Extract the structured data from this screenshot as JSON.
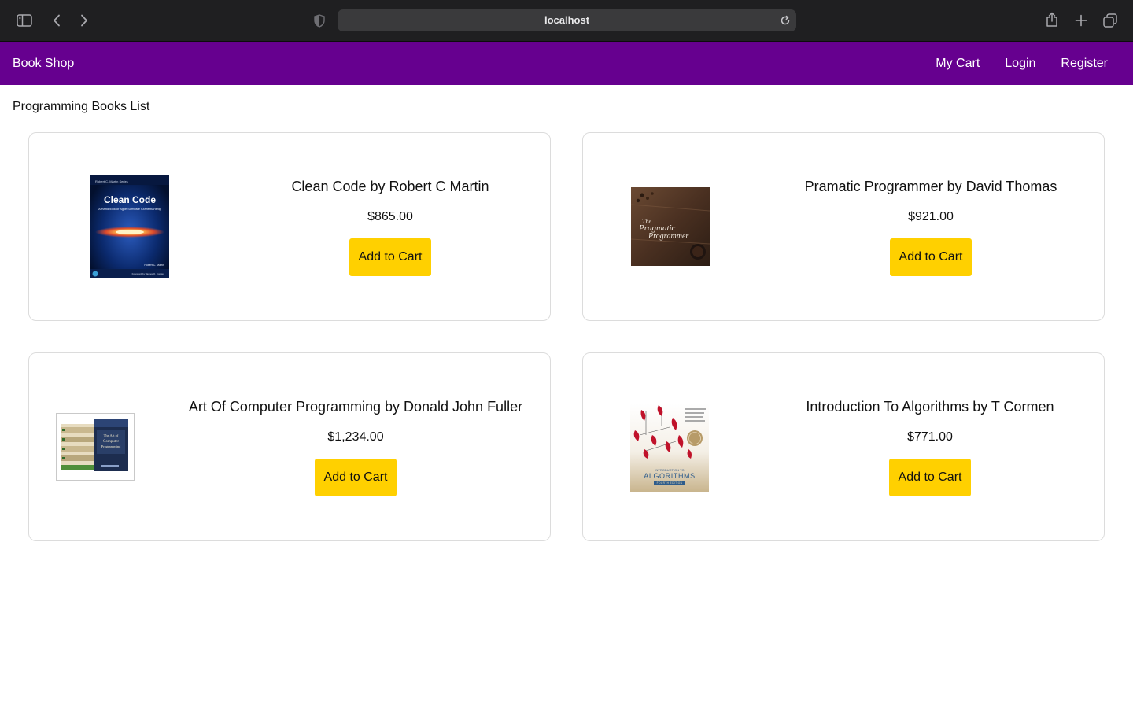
{
  "browser": {
    "url": "localhost",
    "icons": [
      "sidebar-icon",
      "back-icon",
      "forward-icon",
      "privacy-shield-icon",
      "reload-icon",
      "share-icon",
      "new-tab-icon",
      "tabs-overview-icon"
    ]
  },
  "nav": {
    "brand": "Book Shop",
    "links": [
      "My Cart",
      "Login",
      "Register"
    ]
  },
  "page": {
    "heading": "Programming Books List"
  },
  "books": [
    {
      "title": "Clean Code by Robert C Martin",
      "price": "$865.00",
      "button": "Add to Cart",
      "cover": {
        "series": "Robert C. Martin Series",
        "title": "Clean Code",
        "subtitle": "A Handbook of Agile Software Craftsmanship",
        "author": "Robert C. Martin",
        "foreword": "Foreword by James O. Coplien"
      }
    },
    {
      "title": "Pramatic Programmer by David Thomas",
      "price": "$921.00",
      "button": "Add to Cart",
      "cover": {
        "line1": "The",
        "line2": "Pragmatic",
        "line3": "Programmer"
      }
    },
    {
      "title": "Art Of Computer Programming by Donald John Fuller",
      "price": "$1,234.00",
      "button": "Add to Cart",
      "cover": {
        "line1": "The Art of",
        "line2": "Computer",
        "line3": "Programming"
      }
    },
    {
      "title": "Introduction To Algorithms by T Cormen",
      "price": "$771.00",
      "button": "Add to Cart",
      "cover": {
        "intro": "INTRODUCTION TO",
        "title": "ALGORITHMS",
        "edition": "FOURTH EDITION"
      }
    }
  ],
  "colors": {
    "nav_bg": "#66008f",
    "button_bg": "#ffd000",
    "chrome_bg": "#1f1f21"
  }
}
